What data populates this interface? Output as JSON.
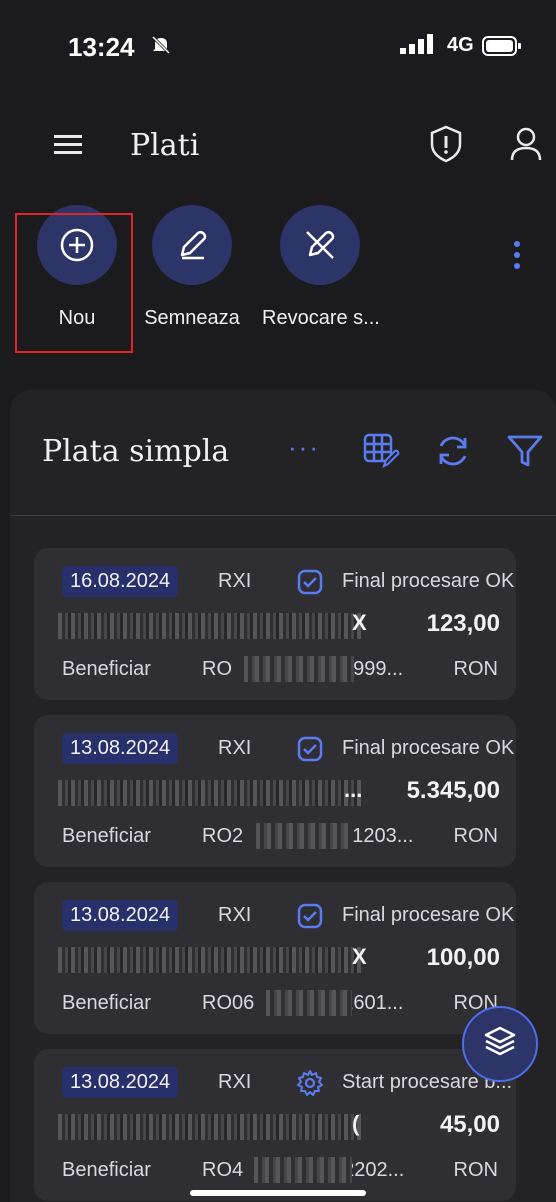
{
  "status_bar": {
    "time": "13:24",
    "network": "4G"
  },
  "header": {
    "title": "Plati"
  },
  "actions": [
    {
      "label": "Nou",
      "icon": "plus-circle-icon"
    },
    {
      "label": "Semneaza",
      "icon": "pen-icon"
    },
    {
      "label": "Revocare s...",
      "icon": "pen-off-icon"
    }
  ],
  "sheet": {
    "title": "Plata simpla",
    "more": "···"
  },
  "payments": [
    {
      "date": "16.08.2024",
      "code": "RXI",
      "status": "Final procesare OK",
      "status_icon": "check-badge-icon",
      "name_tail": "X",
      "amount": "123,00",
      "beneficiar": "Beneficiar",
      "iban_prefix": "RO",
      "iban_tail": "9999...",
      "currency": "RON"
    },
    {
      "date": "13.08.2024",
      "code": "RXI",
      "status": "Final procesare OK",
      "status_icon": "check-badge-icon",
      "name_tail": "...",
      "amount": "5.345,00",
      "beneficiar": "Beneficiar",
      "iban_prefix": "RO2",
      "iban_tail": "01203...",
      "currency": "RON"
    },
    {
      "date": "13.08.2024",
      "code": "RXI",
      "status": "Final procesare OK",
      "status_icon": "check-badge-icon",
      "name_tail": "X",
      "amount": "100,00",
      "beneficiar": "Beneficiar",
      "iban_prefix": "RO06",
      "iban_tail": "1601...",
      "currency": "RON"
    },
    {
      "date": "13.08.2024",
      "code": "RXI",
      "status": "Start procesare b...",
      "status_icon": "gear-icon",
      "name_tail": "(",
      "amount": "45,00",
      "beneficiar": "Beneficiar",
      "iban_prefix": "RO4",
      "iban_tail": "2202...",
      "currency": "RON"
    }
  ],
  "colors": {
    "accent": "#5b7cf0",
    "button_bg": "#2c3468",
    "highlight": "#e0242b"
  }
}
